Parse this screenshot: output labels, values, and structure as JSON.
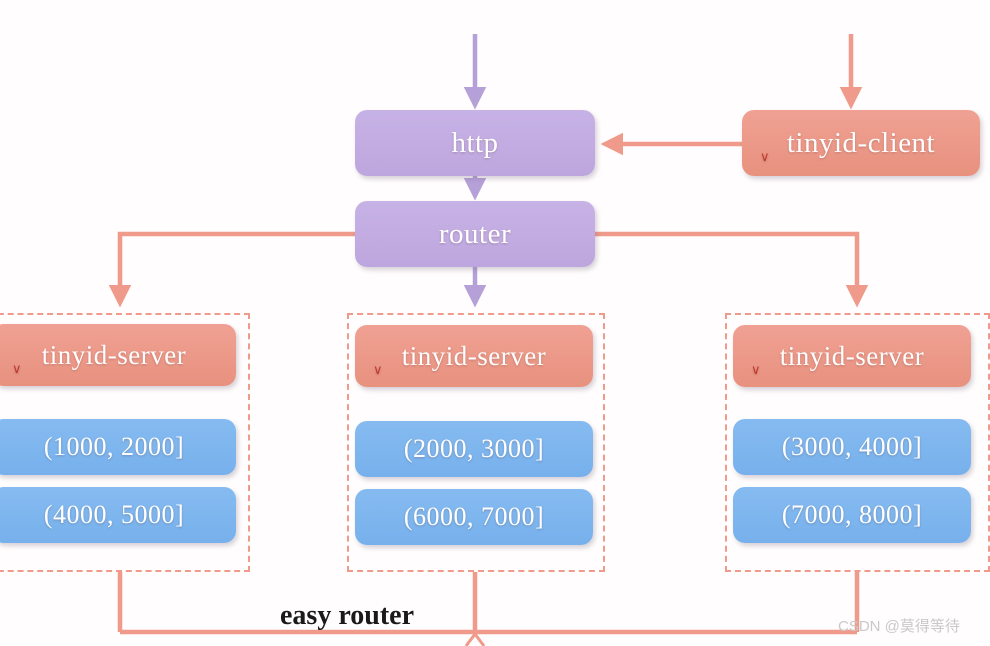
{
  "diagram": {
    "title_caption": "easy router",
    "watermark": "CSDN @莫得等待",
    "colors": {
      "purple": "#c3ace3",
      "salmon": "#ef9a8a",
      "blue": "#7cb5ee",
      "dashed_border": "#ef9a8a",
      "caption_text": "#1a1a1a",
      "watermark_text": "#c9c9c9",
      "background": "#fffdfd"
    },
    "nodes": {
      "http": {
        "label": "http"
      },
      "router": {
        "label": "router"
      },
      "client": {
        "label": "tinyid-client"
      }
    },
    "groups": [
      {
        "server_label": "tinyid-server",
        "ranges": [
          {
            "label": "(1000, 2000]"
          },
          {
            "label": "(4000, 5000]"
          }
        ]
      },
      {
        "server_label": "tinyid-server",
        "ranges": [
          {
            "label": "(2000, 3000]"
          },
          {
            "label": "(6000, 7000]"
          }
        ]
      },
      {
        "server_label": "tinyid-server",
        "ranges": [
          {
            "label": "(3000, 4000]"
          },
          {
            "label": "(7000, 8000]"
          }
        ]
      }
    ],
    "spell_marks": [
      {
        "name": "spell-mark-client"
      },
      {
        "name": "spell-mark-server-1"
      },
      {
        "name": "spell-mark-server-2"
      },
      {
        "name": "spell-mark-server-3"
      }
    ],
    "connectors": [
      {
        "name": "inbound-to-http",
        "color": "#b6a0d8"
      },
      {
        "name": "inbound-to-client",
        "color": "#ef9a8a"
      },
      {
        "name": "client-to-http",
        "color": "#ef9a8a"
      },
      {
        "name": "http-to-router",
        "color": "#b6a0d8"
      },
      {
        "name": "router-to-group-left",
        "color": "#ef9a8a"
      },
      {
        "name": "router-to-group-middle",
        "color": "#b6a0d8"
      },
      {
        "name": "router-to-group-right",
        "color": "#ef9a8a"
      },
      {
        "name": "group-left-to-bus",
        "color": "#ef9a8a"
      },
      {
        "name": "group-middle-to-bus",
        "color": "#ef9a8a"
      },
      {
        "name": "group-right-to-bus",
        "color": "#ef9a8a"
      },
      {
        "name": "bus-to-router-feedback",
        "color": "#ef9a8a"
      }
    ]
  },
  "chart_data": {
    "type": "diagram",
    "title": "easy router",
    "node_count": 12,
    "id_ranges": [
      "(1000, 2000]",
      "(4000, 5000]",
      "(2000, 3000]",
      "(6000, 7000]",
      "(3000, 4000]",
      "(7000, 8000]"
    ]
  }
}
